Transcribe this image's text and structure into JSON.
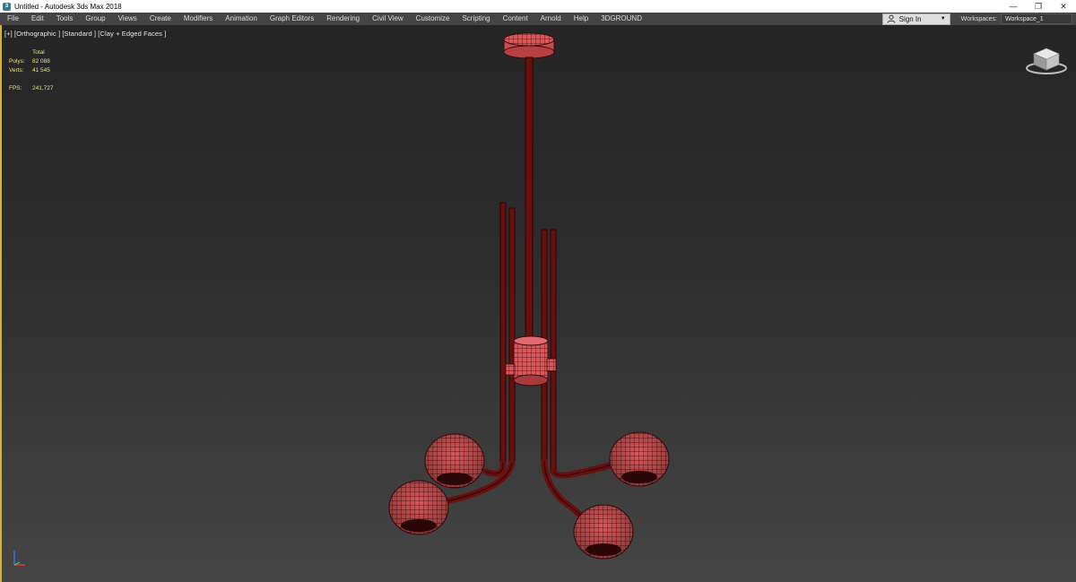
{
  "window": {
    "title": "Untitled - Autodesk 3ds Max 2018",
    "app_icon_glyph": "3",
    "controls": {
      "minimize": "—",
      "restore": "❐",
      "close": "✕"
    }
  },
  "menu": {
    "items": [
      "File",
      "Edit",
      "Tools",
      "Group",
      "Views",
      "Create",
      "Modifiers",
      "Animation",
      "Graph Editors",
      "Rendering",
      "Civil View",
      "Customize",
      "Scripting",
      "Content",
      "Arnold",
      "Help",
      "3DGROUND"
    ],
    "sign_in": "Sign In",
    "workspaces_label": "Workspaces:",
    "workspace_value": "Workspace_1"
  },
  "viewport": {
    "label": "[+] [Orthographic ] [Standard ] [Clay + Edged Faces ]",
    "stats": {
      "header": "Total",
      "polys_label": "Polys:",
      "polys_value": "82 088",
      "verts_label": "Verts:",
      "verts_value": "41 545",
      "fps_label": "FPS:",
      "fps_value": "241,727"
    },
    "model_color": "#d8585a",
    "wire_color": "#3a0808",
    "stem_color": "#6a0e0e"
  }
}
